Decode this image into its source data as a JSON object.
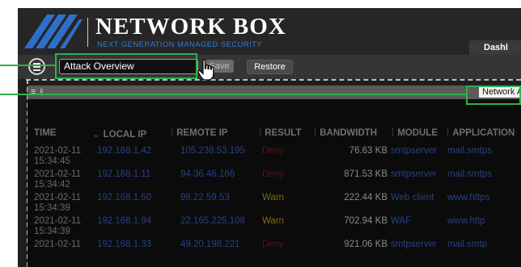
{
  "brand": {
    "title": "NETWORK BOX",
    "subtitle": "NEXT GENERATION MANAGED SECURITY"
  },
  "tabs": {
    "dashboard": "Dashl"
  },
  "toolbar": {
    "view_name": "Attack Overview",
    "save_label": "Save",
    "restore_label": "Restore"
  },
  "filter_bar": {
    "filter_icon": "≡ ⫲",
    "network_activity": "Network Ac"
  },
  "table": {
    "columns": [
      "TIME",
      "LOCAL IP",
      "REMOTE IP",
      "RESULT",
      "BANDWIDTH",
      "MODULE",
      "APPLICATION"
    ],
    "rows": [
      {
        "date": "2021-02-11",
        "time": "15:34:45",
        "local_ip": "192.168.1.42",
        "remote_ip": "105.238.53.195",
        "result": "Deny",
        "bandwidth": "76.63 KB",
        "module": "smtpserver",
        "application": "mail.smtps"
      },
      {
        "date": "2021-02-11",
        "time": "15:34:42",
        "local_ip": "192.168.1.11",
        "remote_ip": "94.36.46.166",
        "result": "Deny",
        "bandwidth": "871.53 KB",
        "module": "smtpserver",
        "application": "mail.smtps"
      },
      {
        "date": "2021-02-11",
        "time": "15:34:39",
        "local_ip": "192.168.1.50",
        "remote_ip": "98.22.59.53",
        "result": "Warn",
        "bandwidth": "222.44 KB",
        "module": "Web client",
        "application": "www.https"
      },
      {
        "date": "2021-02-11",
        "time": "15:34:39",
        "local_ip": "192.168.1.94",
        "remote_ip": "22.165.225.108",
        "result": "Warn",
        "bandwidth": "702.94 KB",
        "module": "WAF",
        "application": "www.http"
      },
      {
        "date": "2021-02-11",
        "time": "",
        "local_ip": "192.168.1.33",
        "remote_ip": "49.20.198.221",
        "result": "Deny",
        "bandwidth": "921.06 KB",
        "module": "smtpserver",
        "application": "mail.smtp"
      }
    ]
  },
  "colors": {
    "highlight": "#2db34a",
    "deny": "#5a1313",
    "warn": "#7f6a12",
    "link": "#27417f"
  },
  "icons": {
    "menu": "hamburger-menu-icon",
    "cursor": "hand-cursor-icon",
    "logo": "network-box-logo-icon"
  }
}
